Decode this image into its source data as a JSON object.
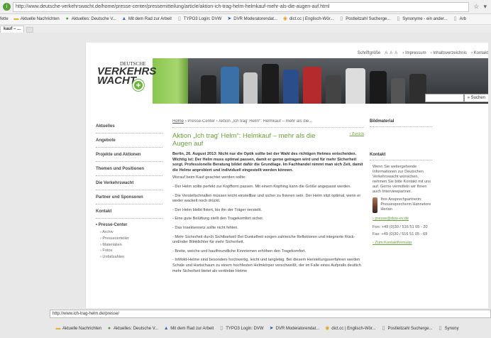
{
  "browser": {
    "url": "http://www.deutsche-verkehrswacht.de/home/presse-center/pressemitteilung/article/aktion-ich-trag-helm-helmkauf-mehr-als-die-augen-auf.html",
    "tab_label": "kauf – ...",
    "status_url": "http://www.ich-trag-helm.de/presse/",
    "bookmarks": [
      {
        "label": "fette",
        "icon": ""
      },
      {
        "label": "Aktuelle Nachrichten",
        "icon": "folder-icon"
      },
      {
        "label": "Aktuelles: Deutsche V...",
        "icon": "green-dot-icon"
      },
      {
        "label": "Mit dem Rad zur Arbeit",
        "icon": "bike-icon"
      },
      {
        "label": "TYPO3 Login: DVW",
        "icon": "page-icon"
      },
      {
        "label": "DVR Moderatorendat...",
        "icon": "arrow-icon"
      },
      {
        "label": "dict.cc | Englisch-Wör...",
        "icon": "dict-icon"
      },
      {
        "label": "Postleitzahl Sucherge...",
        "icon": "page-icon"
      },
      {
        "label": "Synonyme - ein ander...",
        "icon": "page-icon"
      },
      {
        "label": "Arb",
        "icon": "page-icon"
      }
    ],
    "taskbar": [
      {
        "label": "Aktuelle Nachrichten",
        "icon": "folder-icon"
      },
      {
        "label": "Aktuelles: Deutsche V...",
        "icon": "green-dot-icon"
      },
      {
        "label": "Mit dem Rad zur Arbeit",
        "icon": "bike-icon"
      },
      {
        "label": "TYPO3 Login: DVW",
        "icon": "page-icon"
      },
      {
        "label": "DVR Moderatorendat...",
        "icon": "arrow-icon"
      },
      {
        "label": "dict.cc | Englisch-Wör...",
        "icon": "dict-icon"
      },
      {
        "label": "Postleitzahl Sucherge...",
        "icon": "page-icon"
      },
      {
        "label": "Synony",
        "icon": "page-icon"
      }
    ]
  },
  "site": {
    "logo_small": "DEUTSCHE",
    "logo_big": "VERKEHRS WACHT",
    "topnav": {
      "textsize": "Schriftgröße",
      "textsize_glyph": "A A A",
      "impressum": "› Impressum",
      "inhalt": "› Inhaltsverzeichnis",
      "kontakt": "› Kontakt"
    },
    "search_button": "» Suchen",
    "leftnav": [
      "Aktuelles",
      "Angebote",
      "Projekte und Aktionen",
      "Themen und Positionen",
      "Die Verkehrswacht",
      "Partner und Sponsoren",
      "Kontakt"
    ],
    "presse_title": "• Presse-Center",
    "presse_items": [
      "› Archiv",
      "› Presseverteiler",
      "› Materialien",
      "› Fotos",
      "› Unfallzahlen"
    ],
    "breadcrumb": {
      "home": "Home",
      "sep": "›",
      "presse": "Presse-Center",
      "current": "Aktion „Ich trag' Helm“: Helmkauf – mehr als die..."
    },
    "title": "Aktion „Ich trag' Helm“: Helmkauf – mehr als die Augen auf",
    "back": "‹ Zurück",
    "intro": "Berlin, 26. August 2013: Nicht nur die Optik sollte bei der Wahl des richtigen Helmes entscheiden. Wichtig ist: Der Helm muss optimal passen, damit er gerne getragen wird und für mehr Sicherheit sorgt. Professionelle Beratung bildet dafür die Grundlage. Im Fachhandel nimmt man sich Zeit, damit die Helme anprobiert und individuell eingestellt werden können.",
    "p1": "Worauf beim Kauf geachtet werden sollte:",
    "bullets": [
      "- Der Helm sollte perfekt zur Kopfform passen. Mit einem Kopfring kann die Größe angepasst werden.",
      "- Die Verstellschnallen müssen leicht einstellbar und sicher zu fixieren sein. Der Helm sitzt optimal, wenn er weder wackelt noch drückt.",
      "- Der Helm bleibt fixiert, bis ihn der Träger verstellt.",
      "- Eine gute Belüftung stellt den Tragekomfort sicher.",
      "- Das Insektennetz sollte nicht fehlen.",
      "- Mehr Sicherheit durch Sichtbarkeit! Bei Dunkelheit sorgen zahlreiche Reflektoren und integrierte Rück- und/oder Blinklichter für mehr Sicherheit.",
      "- Breite, weiche und hautfreundliche Kinnriemen erhöhen den Tragekomfort.",
      "- InMold-Helme sind besonders hochwertig, leicht und langlebig. Bei diesem Herstellungsverfahren werden Schale und Hartschaum zu einem hochfesten Helmkörper verschweißt, der im Falle eines Aufpralls deutlich mehr Sicherheit bietet als verklebte Helme"
    ],
    "right": {
      "bildmaterial": "Bildmaterial",
      "kontakt": "Kontakt",
      "kontakt_text": "Wenn Sie weitergehende Informationen zur Deutschen Verkehrswacht wünschen, nehmen Sie bitte Kontakt mit uns auf. Gerne vermitteln wir Ihnen auch Interviewpartner.",
      "person": "Ihre Ansprechpartnerin: Pressesprecherin Hannelore Herlan",
      "email": "› presse@dvw-ev.de",
      "fon": "Fon: +49 (0)30 / 516 51 05 - 20",
      "fax": "Fax: +49 (0)30 / 516 51 05 - 69",
      "form": "› Zum Kontaktformular"
    }
  }
}
